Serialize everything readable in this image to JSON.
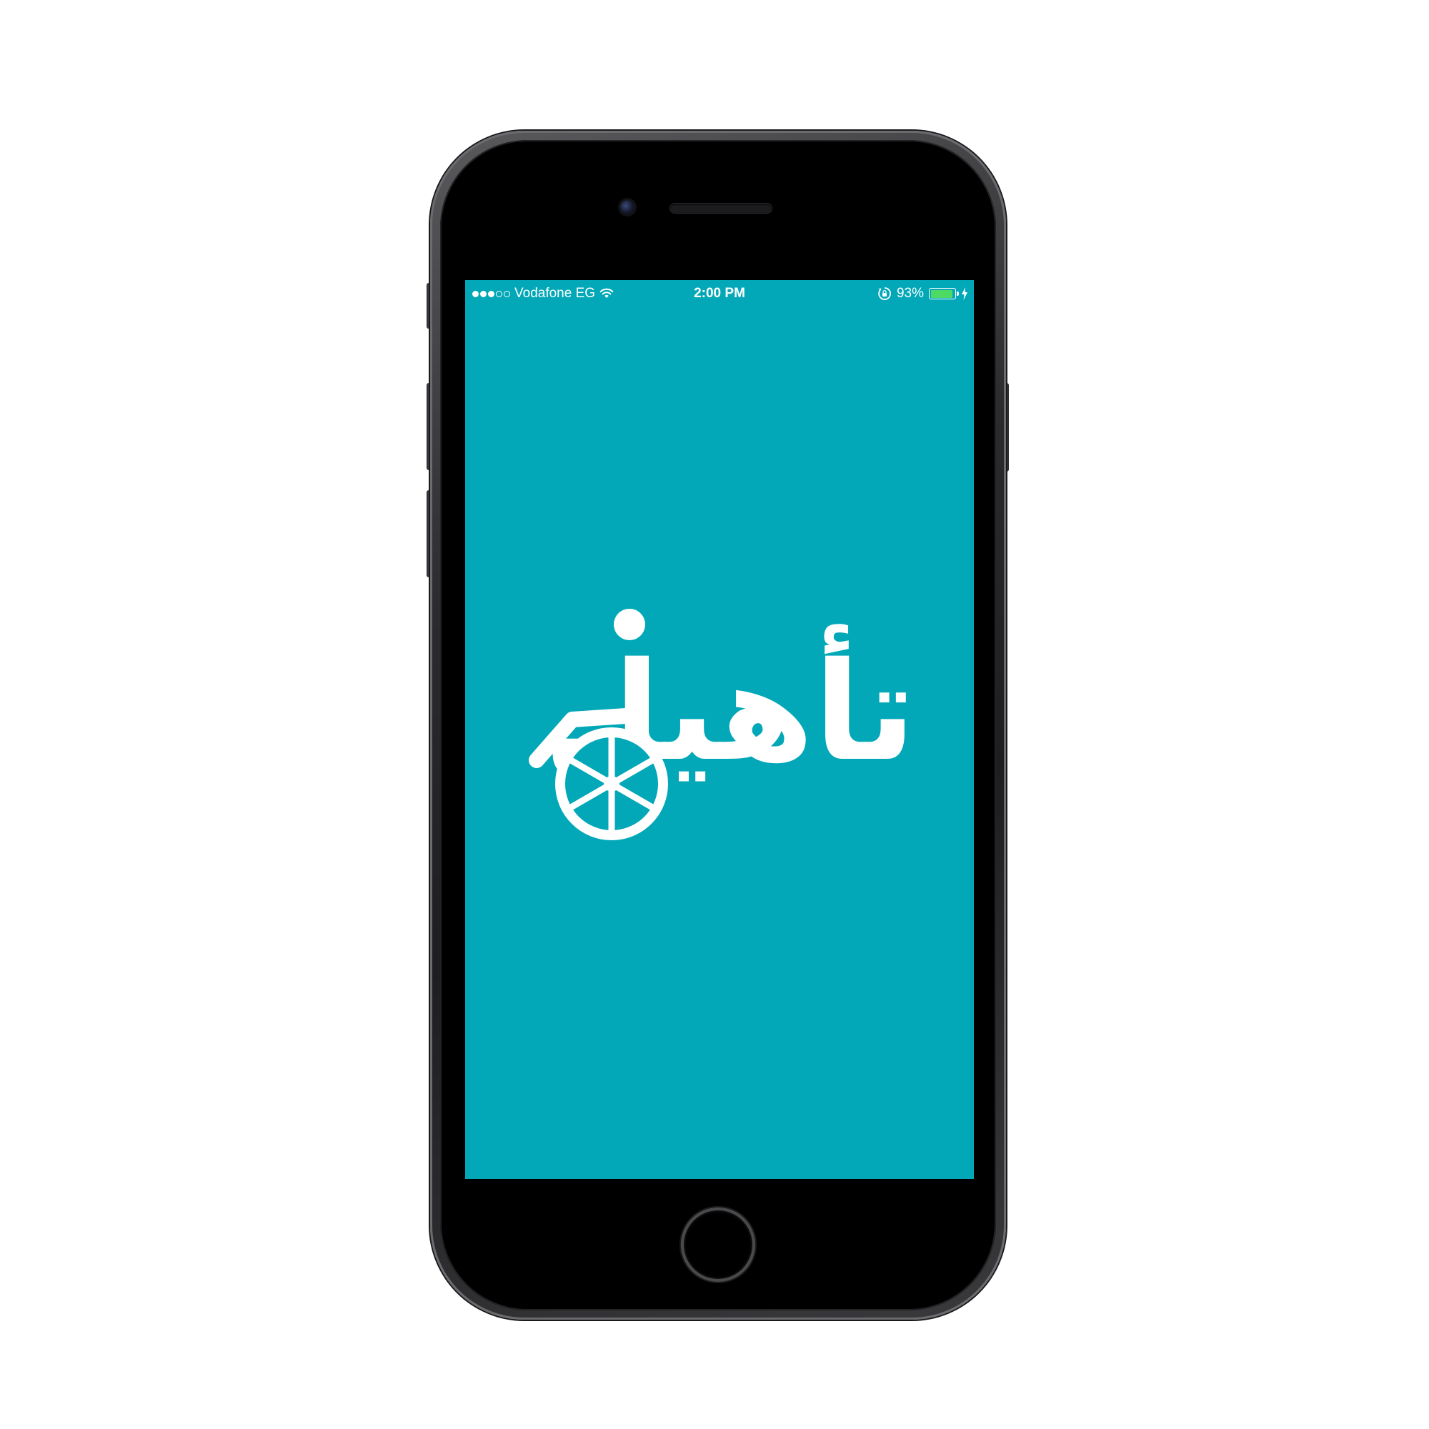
{
  "device": {
    "model": "iPhone",
    "body_color": "#2b2b2d"
  },
  "status_bar": {
    "signal_bars_total": 5,
    "signal_bars_filled": 3,
    "carrier": "Vodafone EG",
    "wifi_icon": "wifi-icon",
    "time": "2:00 PM",
    "rotation_lock_icon": "rotation-lock-icon",
    "battery_percent_label": "93%",
    "battery_level": 0.93,
    "charging_icon": "charging-bolt-icon"
  },
  "splash": {
    "background_color": "#02a8b7",
    "logo_text": "تأهيل",
    "logo_color": "#ffffff",
    "logo_icon": "wheelchair-wheel-icon"
  }
}
